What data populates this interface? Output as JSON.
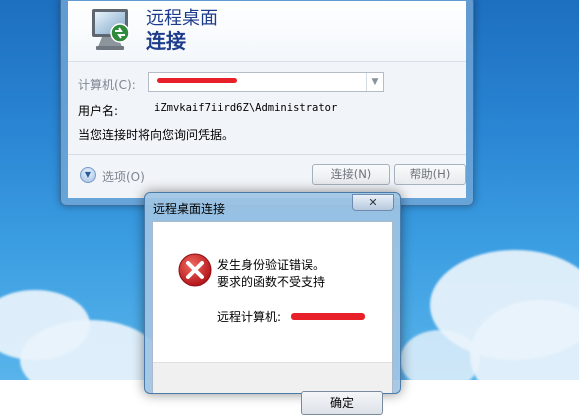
{
  "rdp_window": {
    "title_line1": "远程桌面",
    "title_line2": "连接",
    "computer_label": "计算机(C):",
    "computer_value": "",
    "username_label": "用户名:",
    "username_value": "iZmvkaif7iird6Z\\Administrator",
    "credential_note": "当您连接时将向您询问凭据。",
    "options_label": "选项(O)",
    "connect_label": "连接(N)",
    "help_label": "帮助(H)"
  },
  "error_dialog": {
    "title": "远程桌面连接",
    "close_glyph": "✕",
    "message_line1": "发生身份验证错误。",
    "message_line2": "要求的函数不受支持",
    "remote_computer_label": "远程计算机:",
    "ok_label": "确定"
  },
  "colors": {
    "redaction": "#e8202a",
    "title_blue": "#1e3c8c",
    "error_red": "#d42323"
  },
  "icons": {
    "app": "remote-desktop-icon",
    "options": "chevron-down-icon",
    "error": "error-icon",
    "close": "close-icon"
  }
}
